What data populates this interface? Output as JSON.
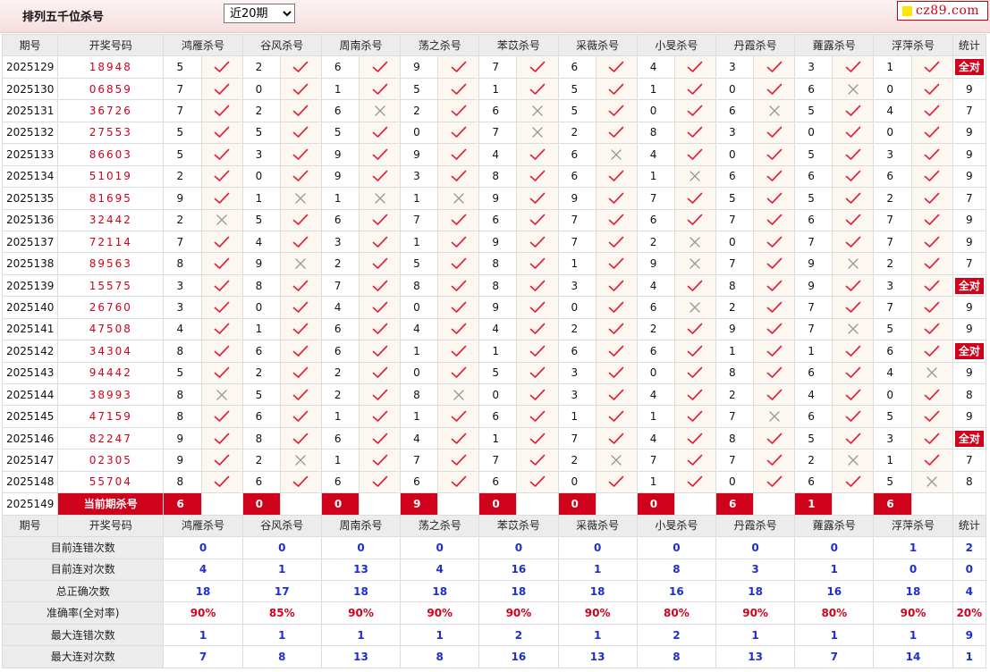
{
  "header": {
    "title": "排列五千位杀号",
    "range_selected": "近20期",
    "logo_text": "cz89.com"
  },
  "table": {
    "columns": [
      "期号",
      "开奖号码",
      "鸿雁杀号",
      "谷风杀号",
      "周南杀号",
      "荡之杀号",
      "苯苡杀号",
      "采薇杀号",
      "小旻杀号",
      "丹霞杀号",
      "蕹露杀号",
      "浮萍杀号",
      "统计"
    ],
    "full_correct_label": "全对",
    "rows": [
      {
        "period": "2025129",
        "draw": "18948",
        "kills": [
          "5",
          "2",
          "6",
          "9",
          "7",
          "6",
          "4",
          "3",
          "3",
          "1"
        ],
        "marks": [
          1,
          1,
          1,
          1,
          1,
          1,
          1,
          1,
          1,
          1
        ],
        "stat": "全对"
      },
      {
        "period": "2025130",
        "draw": "06859",
        "kills": [
          "7",
          "0",
          "1",
          "5",
          "1",
          "5",
          "1",
          "0",
          "6",
          "0"
        ],
        "marks": [
          1,
          1,
          1,
          1,
          1,
          1,
          1,
          1,
          0,
          1
        ],
        "stat": "9"
      },
      {
        "period": "2025131",
        "draw": "36726",
        "kills": [
          "7",
          "2",
          "6",
          "2",
          "6",
          "5",
          "0",
          "6",
          "5",
          "4"
        ],
        "marks": [
          1,
          1,
          0,
          1,
          0,
          1,
          1,
          0,
          1,
          1
        ],
        "stat": "7"
      },
      {
        "period": "2025132",
        "draw": "27553",
        "kills": [
          "5",
          "5",
          "5",
          "0",
          "7",
          "2",
          "8",
          "3",
          "0",
          "0"
        ],
        "marks": [
          1,
          1,
          1,
          1,
          0,
          1,
          1,
          1,
          1,
          1
        ],
        "stat": "9"
      },
      {
        "period": "2025133",
        "draw": "86603",
        "kills": [
          "5",
          "3",
          "9",
          "9",
          "4",
          "6",
          "4",
          "0",
          "5",
          "3"
        ],
        "marks": [
          1,
          1,
          1,
          1,
          1,
          0,
          1,
          1,
          1,
          1
        ],
        "stat": "9"
      },
      {
        "period": "2025134",
        "draw": "51019",
        "kills": [
          "2",
          "0",
          "9",
          "3",
          "8",
          "6",
          "1",
          "6",
          "6",
          "6"
        ],
        "marks": [
          1,
          1,
          1,
          1,
          1,
          1,
          0,
          1,
          1,
          1
        ],
        "stat": "9"
      },
      {
        "period": "2025135",
        "draw": "81695",
        "kills": [
          "9",
          "1",
          "1",
          "1",
          "9",
          "9",
          "7",
          "5",
          "5",
          "2"
        ],
        "marks": [
          1,
          0,
          0,
          0,
          1,
          1,
          1,
          1,
          1,
          1
        ],
        "stat": "7"
      },
      {
        "period": "2025136",
        "draw": "32442",
        "kills": [
          "2",
          "5",
          "6",
          "7",
          "6",
          "7",
          "6",
          "7",
          "6",
          "7"
        ],
        "marks": [
          0,
          1,
          1,
          1,
          1,
          1,
          1,
          1,
          1,
          1
        ],
        "stat": "9"
      },
      {
        "period": "2025137",
        "draw": "72114",
        "kills": [
          "7",
          "4",
          "3",
          "1",
          "9",
          "7",
          "2",
          "0",
          "7",
          "7"
        ],
        "marks": [
          1,
          1,
          1,
          1,
          1,
          1,
          0,
          1,
          1,
          1
        ],
        "stat": "9"
      },
      {
        "period": "2025138",
        "draw": "89563",
        "kills": [
          "8",
          "9",
          "2",
          "5",
          "8",
          "1",
          "9",
          "7",
          "9",
          "2"
        ],
        "marks": [
          1,
          0,
          1,
          1,
          1,
          1,
          0,
          1,
          0,
          1
        ],
        "stat": "7"
      },
      {
        "period": "2025139",
        "draw": "15575",
        "kills": [
          "3",
          "8",
          "7",
          "8",
          "8",
          "3",
          "4",
          "8",
          "9",
          "3"
        ],
        "marks": [
          1,
          1,
          1,
          1,
          1,
          1,
          1,
          1,
          1,
          1
        ],
        "stat": "全对"
      },
      {
        "period": "2025140",
        "draw": "26760",
        "kills": [
          "3",
          "0",
          "4",
          "0",
          "9",
          "0",
          "6",
          "2",
          "7",
          "7"
        ],
        "marks": [
          1,
          1,
          1,
          1,
          1,
          1,
          0,
          1,
          1,
          1
        ],
        "stat": "9"
      },
      {
        "period": "2025141",
        "draw": "47508",
        "kills": [
          "4",
          "1",
          "6",
          "4",
          "4",
          "2",
          "2",
          "9",
          "7",
          "5"
        ],
        "marks": [
          1,
          1,
          1,
          1,
          1,
          1,
          1,
          1,
          0,
          1
        ],
        "stat": "9"
      },
      {
        "period": "2025142",
        "draw": "34304",
        "kills": [
          "8",
          "6",
          "6",
          "1",
          "1",
          "6",
          "6",
          "1",
          "1",
          "6"
        ],
        "marks": [
          1,
          1,
          1,
          1,
          1,
          1,
          1,
          1,
          1,
          1
        ],
        "stat": "全对"
      },
      {
        "period": "2025143",
        "draw": "94442",
        "kills": [
          "5",
          "2",
          "2",
          "0",
          "5",
          "3",
          "0",
          "8",
          "6",
          "4"
        ],
        "marks": [
          1,
          1,
          1,
          1,
          1,
          1,
          1,
          1,
          1,
          0
        ],
        "stat": "9"
      },
      {
        "period": "2025144",
        "draw": "38993",
        "kills": [
          "8",
          "5",
          "2",
          "8",
          "0",
          "3",
          "4",
          "2",
          "4",
          "0"
        ],
        "marks": [
          0,
          1,
          1,
          0,
          1,
          1,
          1,
          1,
          1,
          1
        ],
        "stat": "8"
      },
      {
        "period": "2025145",
        "draw": "47159",
        "kills": [
          "8",
          "6",
          "1",
          "1",
          "6",
          "1",
          "1",
          "7",
          "6",
          "5"
        ],
        "marks": [
          1,
          1,
          1,
          1,
          1,
          1,
          1,
          0,
          1,
          1
        ],
        "stat": "9"
      },
      {
        "period": "2025146",
        "draw": "82247",
        "kills": [
          "9",
          "8",
          "6",
          "4",
          "1",
          "7",
          "4",
          "8",
          "5",
          "3"
        ],
        "marks": [
          1,
          1,
          1,
          1,
          1,
          1,
          1,
          1,
          1,
          1
        ],
        "stat": "全对"
      },
      {
        "period": "2025147",
        "draw": "02305",
        "kills": [
          "9",
          "2",
          "1",
          "7",
          "7",
          "2",
          "7",
          "7",
          "2",
          "1"
        ],
        "marks": [
          1,
          0,
          1,
          1,
          1,
          0,
          1,
          1,
          0,
          1
        ],
        "stat": "7"
      },
      {
        "period": "2025148",
        "draw": "55704",
        "kills": [
          "8",
          "6",
          "6",
          "6",
          "6",
          "0",
          "1",
          "0",
          "6",
          "5"
        ],
        "marks": [
          1,
          1,
          1,
          1,
          1,
          1,
          1,
          1,
          1,
          0
        ],
        "stat": "8"
      }
    ],
    "current": {
      "period": "2025149",
      "label": "当前期杀号",
      "kills": [
        "6",
        "0",
        "0",
        "9",
        "0",
        "0",
        "0",
        "6",
        "1",
        "6"
      ]
    }
  },
  "summary": {
    "rows": [
      {
        "label": "目前连错次数",
        "values": [
          "0",
          "0",
          "0",
          "0",
          "0",
          "0",
          "0",
          "0",
          "0",
          "1",
          "2"
        ],
        "red": false
      },
      {
        "label": "目前连对次数",
        "values": [
          "4",
          "1",
          "13",
          "4",
          "16",
          "1",
          "8",
          "3",
          "1",
          "0",
          "0"
        ],
        "red": false
      },
      {
        "label": "总正确次数",
        "values": [
          "18",
          "17",
          "18",
          "18",
          "18",
          "18",
          "16",
          "18",
          "16",
          "18",
          "4"
        ],
        "red": false
      },
      {
        "label": "准确率(全对率)",
        "values": [
          "90%",
          "85%",
          "90%",
          "90%",
          "90%",
          "90%",
          "80%",
          "90%",
          "80%",
          "90%",
          "20%"
        ],
        "red": true
      },
      {
        "label": "最大连错次数",
        "values": [
          "1",
          "1",
          "1",
          "1",
          "2",
          "1",
          "2",
          "1",
          "1",
          "1",
          "9"
        ],
        "red": false
      },
      {
        "label": "最大连对次数",
        "values": [
          "7",
          "8",
          "13",
          "8",
          "16",
          "13",
          "8",
          "13",
          "7",
          "14",
          "1"
        ],
        "red": false
      }
    ]
  },
  "colors": {
    "accent_red": "#d0021b",
    "check_red": "#e0243a",
    "cross_gray": "#9a9a9a",
    "summary_blue": "#1d2fd1",
    "header_gray": "#ececec",
    "mark_cell_bg": "#fcf8f1"
  },
  "icons": {
    "correct": "check-icon",
    "wrong": "cross-icon",
    "dropdown": "chevron-down-icon",
    "logo_square": "yellow-square-icon"
  }
}
